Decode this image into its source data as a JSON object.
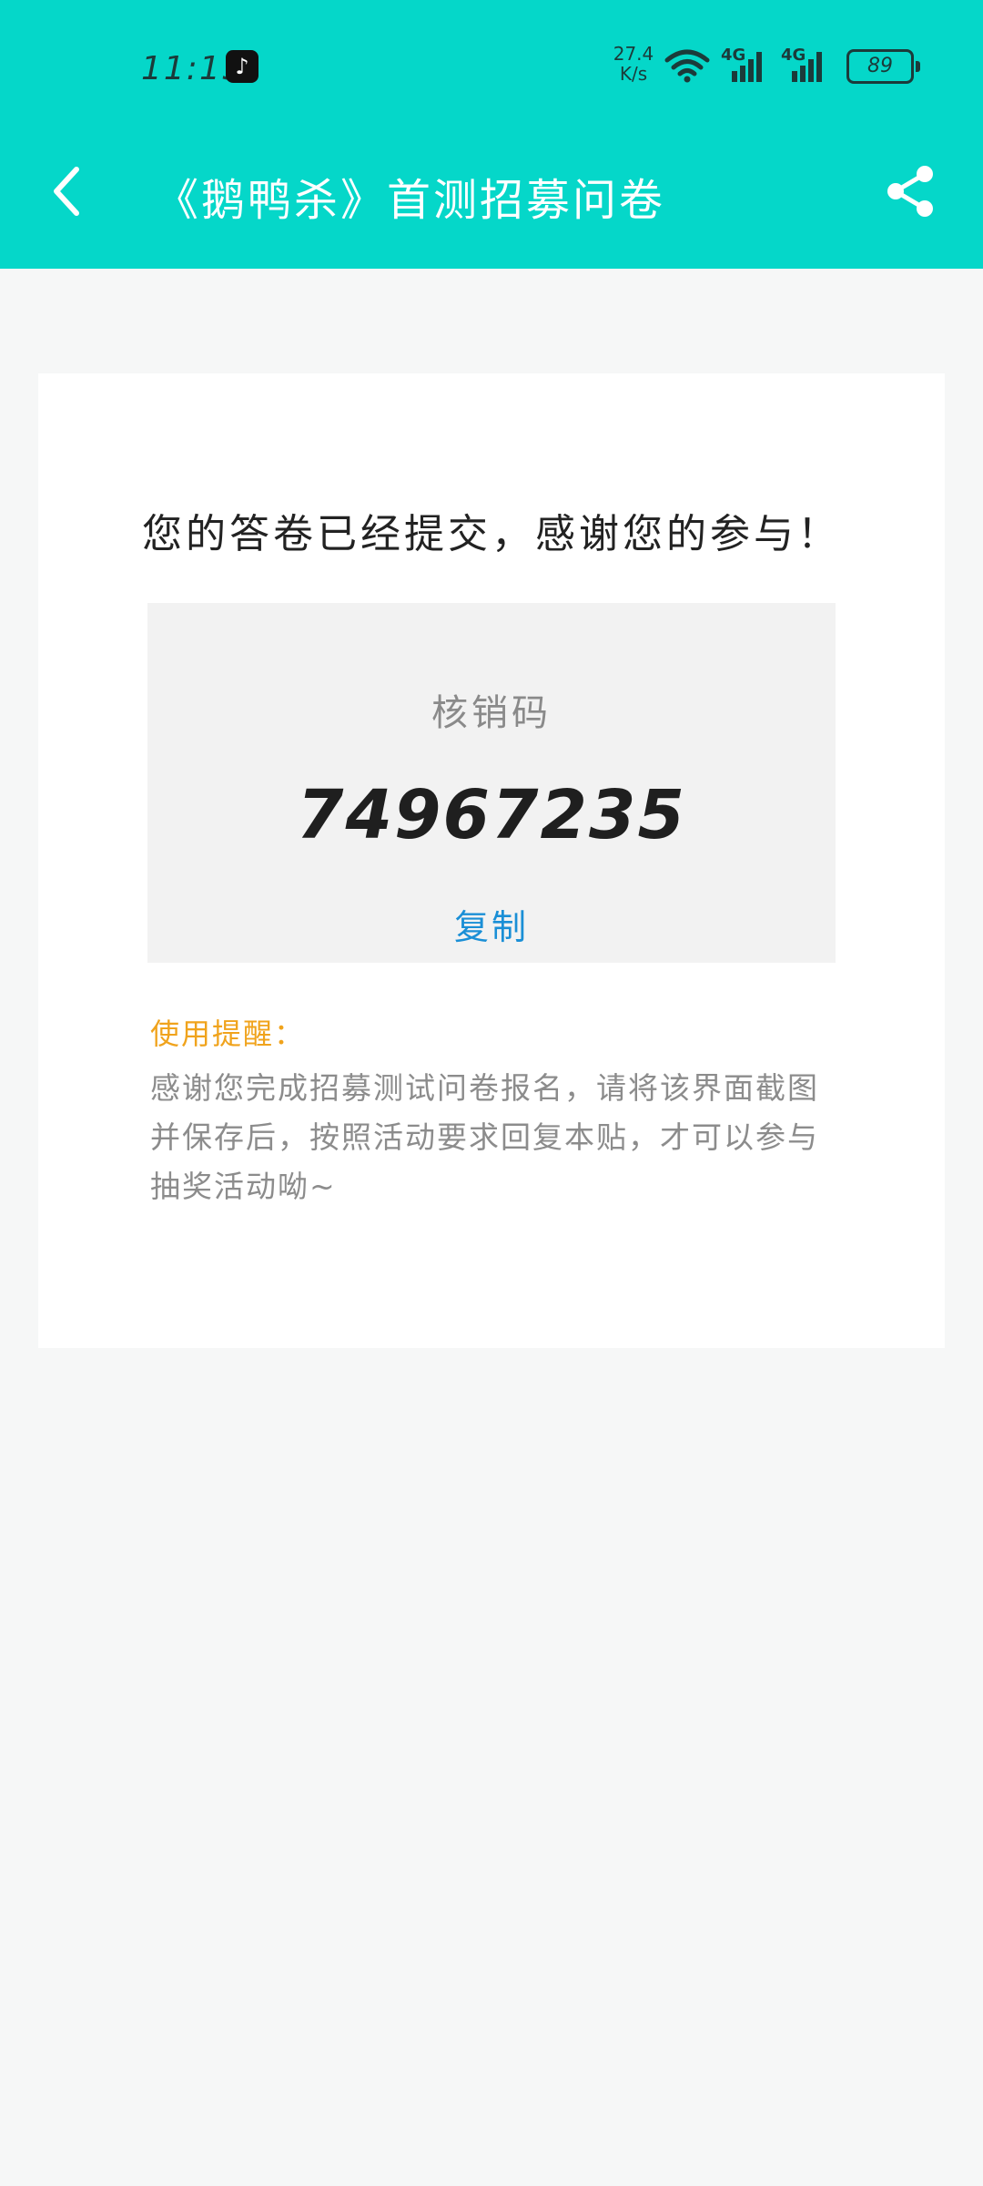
{
  "status_bar": {
    "time": "11:15",
    "net_speed_value": "27.4",
    "net_speed_unit": "K/s",
    "signal_1_label": "4G",
    "signal_2_label": "4G",
    "battery": "89"
  },
  "header": {
    "title": "《鹅鸭杀》首测招募问卷"
  },
  "card": {
    "thanks_message": "您的答卷已经提交，感谢您的参与！",
    "code_label": "核销码",
    "code_value": "74967235",
    "copy_label": "复制",
    "reminder_title": "使用提醒：",
    "reminder_text": "感谢您完成招募测试问卷报名，请将该界面截图并保存后，按照活动要求回复本贴，才可以参与抽奖活动呦~"
  },
  "colors": {
    "header_bg": "#05d7c9",
    "page_bg": "#f6f7f7",
    "copy_link": "#1a8fd6",
    "reminder_title": "#f0a31c"
  }
}
